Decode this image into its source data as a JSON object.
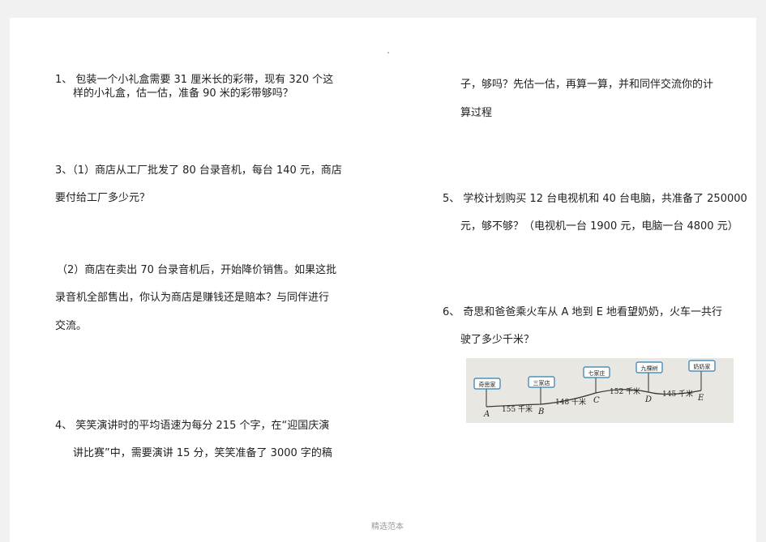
{
  "q1": {
    "line1": "1、  包装一个小礼盒需要  31  厘米长的彩带，现有  320  个这",
    "line2": "样的小礼盒，估一估，准备  90  米的彩带够吗？"
  },
  "q3": {
    "line1": "3、（1）商店从工厂批发了  80  台录音机，每台  140  元，商店",
    "line2": "要付给工厂多少元？",
    "part2_line1": "（2）商店在卖出  70  台录音机后，开始降价销售。如果这批",
    "part2_line2": "录音机全部售出，你认为商店是赚钱还是赔本？与同伴进行",
    "part2_line3": "交流。"
  },
  "q4": {
    "line1": "4、  笑笑演讲时的平均语速为每分  215  个字，在“迎国庆演",
    "line2": "讲比赛”中，需要演讲  15  分，笑笑准备了  3000  字的稿"
  },
  "q4_cont": {
    "line1": "子，够吗？先估一估，再算一算，并和同伴交流你的计",
    "line2": "算过程"
  },
  "q5": {
    "line1": "5、  学校计划购买 12 台电视机和 40 台电脑，共准备了 250000",
    "line2": "元，够不够？（电视机一台  1900  元，电脑一台  4800  元）"
  },
  "q6": {
    "line1": "6、  奇思和爸爸乘火车从 A 地到 E 地看望奶奶，火车一共行",
    "line2": "驶了多少千米？"
  },
  "figure": {
    "signs": [
      "奇思家",
      "三家店",
      "七家庄",
      "九棵树",
      "奶奶家"
    ],
    "points": [
      "A",
      "B",
      "C",
      "D",
      "E"
    ],
    "distances": [
      "155 千米",
      "148 千米",
      "152 千米",
      "145 千米"
    ]
  },
  "footer": "精选范本"
}
